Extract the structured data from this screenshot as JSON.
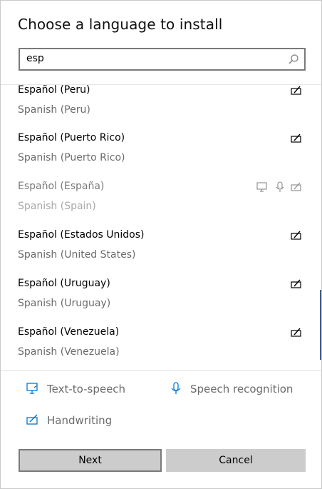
{
  "dialog": {
    "title": "Choose a language to install",
    "search": {
      "value": "esp"
    }
  },
  "languages": [
    {
      "native": "Español (Peru)",
      "english": "Spanish (Peru)",
      "disabled": false,
      "features": [
        "handwriting-icon"
      ]
    },
    {
      "native": "Español (Puerto Rico)",
      "english": "Spanish (Puerto Rico)",
      "disabled": false,
      "features": [
        "handwriting-icon"
      ]
    },
    {
      "native": "Español (España)",
      "english": "Spanish (Spain)",
      "disabled": true,
      "features": [
        "text-to-speech-icon",
        "speech-recognition-icon",
        "handwriting-icon"
      ]
    },
    {
      "native": "Español (Estados Unidos)",
      "english": "Spanish (United States)",
      "disabled": false,
      "features": [
        "handwriting-icon"
      ]
    },
    {
      "native": "Español (Uruguay)",
      "english": "Spanish (Uruguay)",
      "disabled": false,
      "features": [
        "handwriting-icon"
      ]
    },
    {
      "native": "Español (Venezuela)",
      "english": "Spanish (Venezuela)",
      "disabled": false,
      "features": [
        "handwriting-icon"
      ]
    }
  ],
  "legend": {
    "tts": "Text-to-speech",
    "speech": "Speech recognition",
    "handwriting": "Handwriting"
  },
  "buttons": {
    "next": "Next",
    "cancel": "Cancel"
  },
  "colors": {
    "accent": "#0078d7",
    "disabled_text": "#a8a8a8",
    "button_bg": "#cccccc"
  }
}
